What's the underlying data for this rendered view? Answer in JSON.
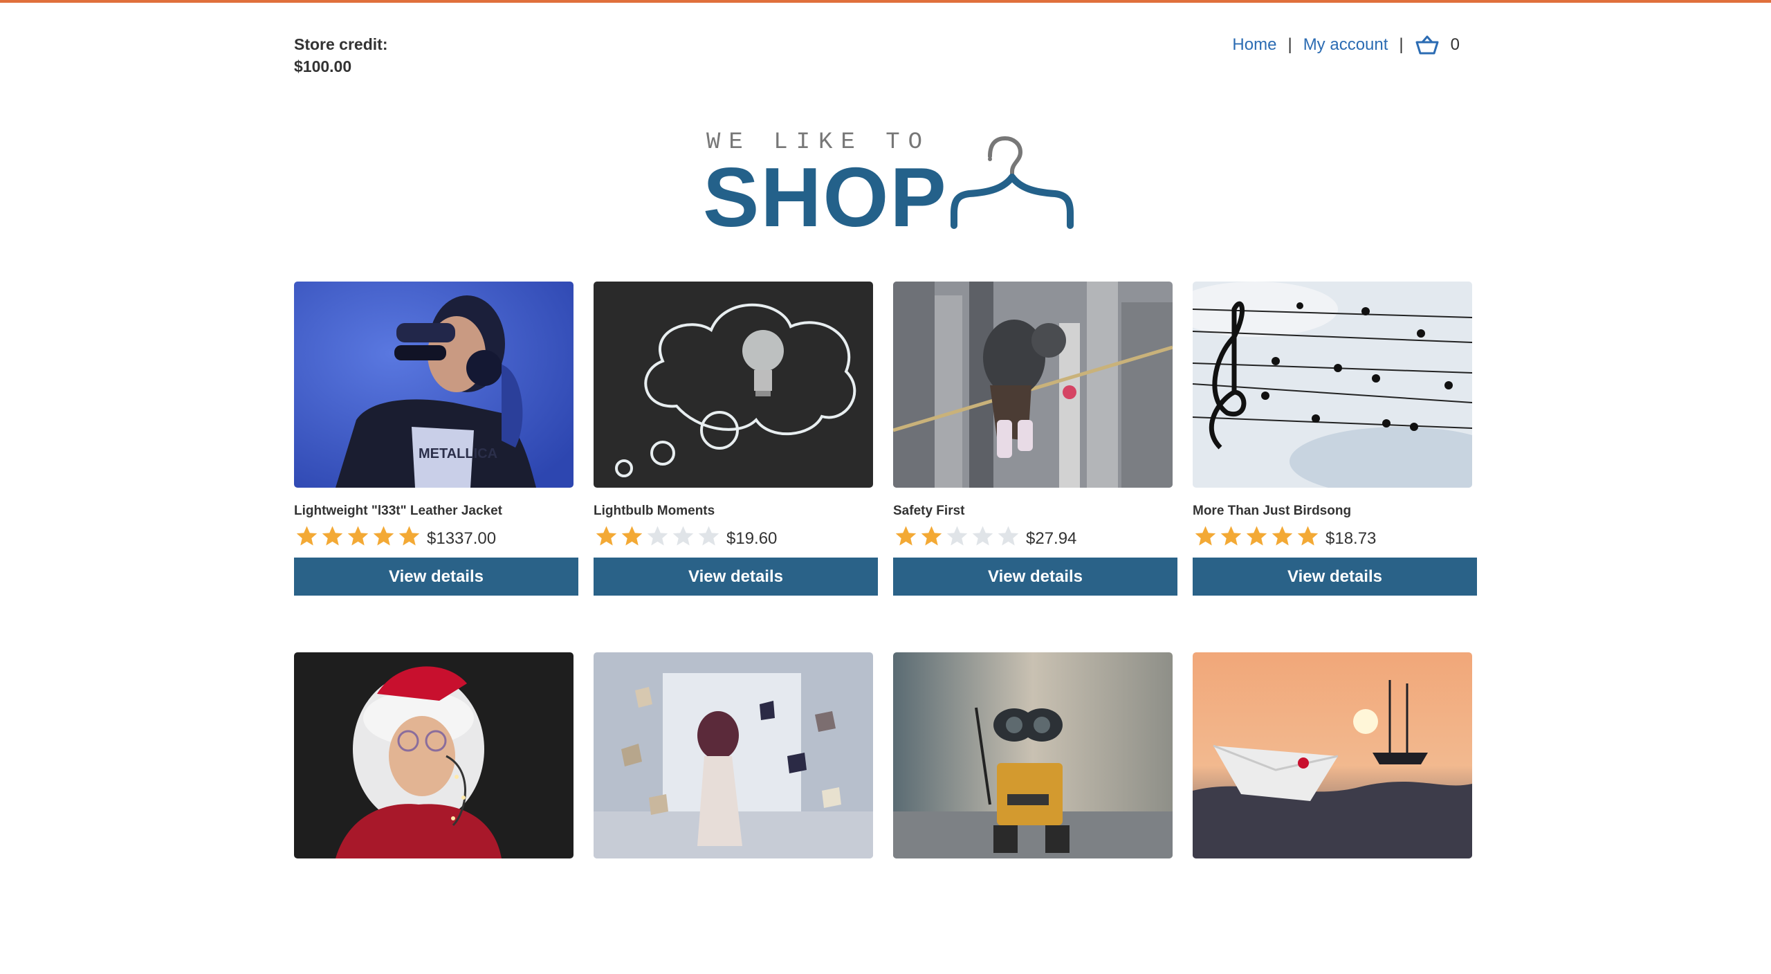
{
  "header": {
    "store_credit_label": "Store credit:",
    "store_credit_amount": "$100.00",
    "nav": {
      "home": "Home",
      "separator": "|",
      "my_account": "My account",
      "cart_icon": "basket-icon",
      "cart_count": "0"
    }
  },
  "logo": {
    "tagline": "WE LIKE TO",
    "word": "SHOP",
    "icon": "coat-hanger-icon"
  },
  "colors": {
    "accent_bar": "#e0703c",
    "brand": "#24618a",
    "button": "#2a6288",
    "link": "#2c6cb3",
    "star_filled": "#f3a935",
    "star_empty": "#e0e4e8"
  },
  "button_label": "View details",
  "products": [
    {
      "name": "Lightweight \"l33t\" Leather Jacket",
      "rating": 5,
      "price": "$1337.00",
      "image": "woman-with-headphones"
    },
    {
      "name": "Lightbulb Moments",
      "rating": 2,
      "price": "$19.60",
      "image": "chalk-thought-bubble-lightbulb"
    },
    {
      "name": "Safety First",
      "rating": 2,
      "price": "$27.94",
      "image": "child-on-tightrope-over-city"
    },
    {
      "name": "More Than Just Birdsong",
      "rating": 5,
      "price": "$18.73",
      "image": "birds-on-wires-music-notes"
    },
    {
      "name": "",
      "rating": null,
      "price": "",
      "image": "man-in-santa-hat-with-lights"
    },
    {
      "name": "",
      "rating": null,
      "price": "",
      "image": "woman-with-flying-books"
    },
    {
      "name": "",
      "rating": null,
      "price": "",
      "image": "robot-toy"
    },
    {
      "name": "",
      "rating": null,
      "price": "",
      "image": "paper-boat-and-ship-at-sunset"
    }
  ]
}
